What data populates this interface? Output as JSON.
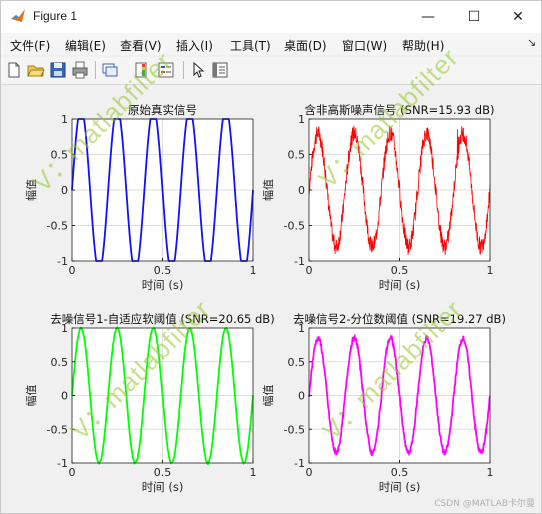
{
  "window": {
    "title": "Figure 1",
    "buttons": {
      "minimize": "—",
      "maximize": "☐",
      "close": "✕"
    }
  },
  "menu": {
    "items": [
      "文件(F)",
      "编辑(E)",
      "查看(V)",
      "插入(I)",
      "工具(T)",
      "桌面(D)",
      "窗口(W)",
      "帮助(H)"
    ],
    "more": "↘"
  },
  "toolbar": {
    "icons": [
      "new-figure-icon",
      "open-file-icon",
      "save-figure-icon",
      "print-figure-icon",
      "link-plot-icon",
      "insert-colorbar-icon",
      "insert-legend-icon",
      "edit-plot-arrow-icon",
      "property-inspector-icon"
    ]
  },
  "watermark": {
    "text": "V：matlabfilter",
    "color": "#9bc52b"
  },
  "credit": "CSDN @MATLAB卡尔曼",
  "chart_data": [
    {
      "type": "line",
      "title": "原始真实信号",
      "xlabel": "时间 (s)",
      "ylabel": "幅值",
      "xlim": [
        0,
        1
      ],
      "ylim": [
        -1,
        1
      ],
      "xticks": [
        "0",
        "0.5",
        "1"
      ],
      "yticks": [
        "-1",
        "-0.5",
        "0",
        "0.5",
        "1"
      ],
      "grid": true,
      "color": "#1010ff",
      "series": [
        {
          "frequency_hz": 5,
          "amplitude": 1,
          "noise": 0,
          "waveform": "clipped sine"
        }
      ]
    },
    {
      "type": "line",
      "title": "含非高斯噪声信号 (SNR=15.93 dB)",
      "xlabel": "时间 (s)",
      "ylabel": "幅值",
      "xlim": [
        0,
        1
      ],
      "ylim": [
        -1,
        1
      ],
      "xticks": [
        "0",
        "0.5",
        "1"
      ],
      "yticks": [
        "-1",
        "-0.5",
        "0",
        "0.5",
        "1"
      ],
      "grid": true,
      "color": "#ff0000",
      "series": [
        {
          "frequency_hz": 5,
          "amplitude": 0.8,
          "noise": 0.12,
          "waveform": "noisy sine with spikes"
        }
      ]
    },
    {
      "type": "line",
      "title": "去噪信号1-自适应软阈值 (SNR=20.65 dB)",
      "xlabel": "时间 (s)",
      "ylabel": "幅值",
      "xlim": [
        0,
        1
      ],
      "ylim": [
        -1,
        1
      ],
      "xticks": [
        "0",
        "0.5",
        "1"
      ],
      "yticks": [
        "-1",
        "-0.5",
        "0",
        "0.5",
        "1"
      ],
      "grid": true,
      "color": "#00ff00",
      "series": [
        {
          "frequency_hz": 5,
          "amplitude": 1,
          "noise": 0.01,
          "waveform": "smooth sine"
        }
      ]
    },
    {
      "type": "line",
      "title": "去噪信号2-分位数阈值 (SNR=19.27 dB)",
      "xlabel": "时间 (s)",
      "ylabel": "幅值",
      "xlim": [
        0,
        1
      ],
      "ylim": [
        -1,
        1
      ],
      "xticks": [
        "0",
        "0.5",
        "1"
      ],
      "yticks": [
        "-1",
        "-0.5",
        "0",
        "0.5",
        "1"
      ],
      "grid": true,
      "color": "#ff00ff",
      "series": [
        {
          "frequency_hz": 5,
          "amplitude": 0.85,
          "noise": 0.04,
          "waveform": "sine with small wiggles"
        }
      ]
    }
  ]
}
